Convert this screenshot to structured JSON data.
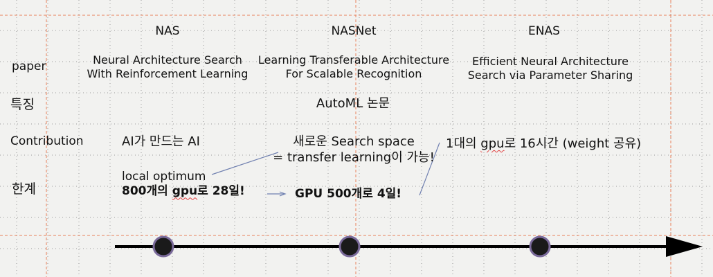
{
  "columns": {
    "nas": {
      "title": "NAS",
      "paper_line1": "Neural Architecture Search",
      "paper_line2": "With Reinforcement Learning",
      "contribution": "AI가 만드는 AI",
      "limit_line1": "local optimum",
      "limit_line2_pre": "800개의 ",
      "limit_line2_gpu": "gpu",
      "limit_line2_post": "로 28일!"
    },
    "nasnet": {
      "title": "NASNet",
      "paper_line1": "Learning Transferable Architecture",
      "paper_line2": "For Scalable Recognition",
      "contribution_line1": "새로운 Search space",
      "contribution_line2": "= transfer learning이 가능!",
      "limit": "GPU 500개로 4일!"
    },
    "enas": {
      "title": "ENAS",
      "paper_line1": "Efficient Neural Architecture",
      "paper_line2": "Search via Parameter Sharing",
      "contribution_pre": "1대의 ",
      "contribution_gpu": "gpu",
      "contribution_post": "로 16시간 (weight 공유)"
    }
  },
  "rows": {
    "paper": "paper",
    "feature": "특징",
    "contribution": "Contribution",
    "limit": "한계"
  },
  "shared_feature": "AutoML 논문",
  "colors": {
    "background": "#f2f2f0",
    "grid_dots": "#9a9a9a",
    "guide_lines": "#e8805a",
    "timeline": "#000000",
    "node_fill": "#1a1a1a",
    "node_ring": "#7a6a9a",
    "connector": "#7080b0"
  }
}
